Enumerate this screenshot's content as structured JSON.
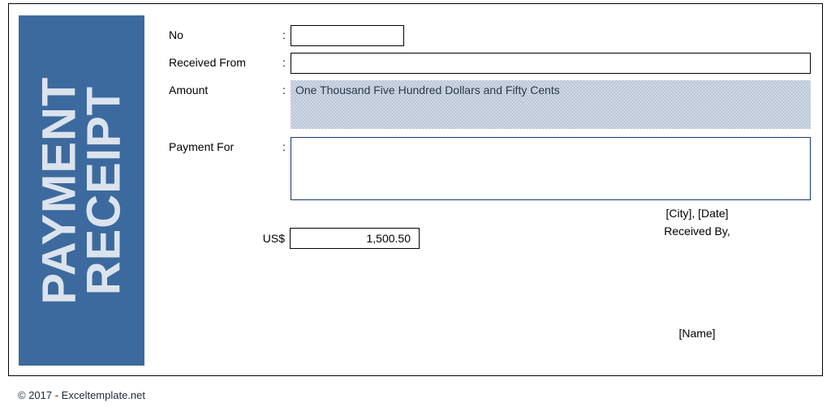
{
  "banner": {
    "line1": "PAYMENT",
    "line2": "RECEIPT"
  },
  "fields": {
    "no_label": "No",
    "no_value": "",
    "received_from_label": "Received From",
    "received_from_value": "",
    "amount_label": "Amount",
    "amount_words": "One Thousand Five Hundred Dollars and Fifty Cents",
    "payment_for_label": "Payment For",
    "payment_for_value": "",
    "colon": ":"
  },
  "currency": {
    "label": "US$",
    "value": "1,500.50"
  },
  "signature": {
    "city_date": "[City], [Date]",
    "received_by": "Received By,",
    "name": "[Name]"
  },
  "footer": "© 2017 - Exceltemplate.net"
}
